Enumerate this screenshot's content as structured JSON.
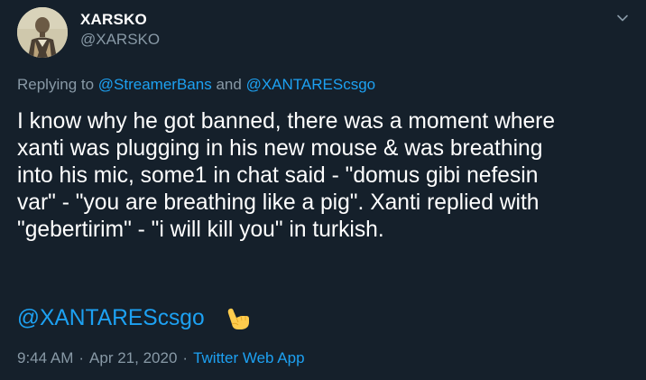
{
  "author": {
    "display_name": "XARSKO",
    "handle": "@XARSKO"
  },
  "reply": {
    "prefix": "Replying to",
    "mention_1": "@StreamerBans",
    "joiner": "and",
    "mention_2": "@XANTAREScsgo"
  },
  "body": {
    "lines": [
      "I know why he got banned, there was a moment where",
      "xanti was plugging in his new mouse & was breathing",
      "into his mic, some1 in chat said - \"domus gibi nefesin",
      "var\" - \"you are breathing like a pig\". Xanti replied with",
      "\"gebertirim\" - \"i will kill you\" in turkish."
    ],
    "mention": "@XANTAREScsgo",
    "emoji": "call-me-hand-emoji"
  },
  "meta": {
    "time": "9:44 AM",
    "date": "Apr 21, 2020",
    "source": "Twitter Web App",
    "separator": "·"
  },
  "colors": {
    "background": "#15202b",
    "text": "#ffffff",
    "secondary": "#8899a6",
    "accent": "#1da1f2"
  }
}
